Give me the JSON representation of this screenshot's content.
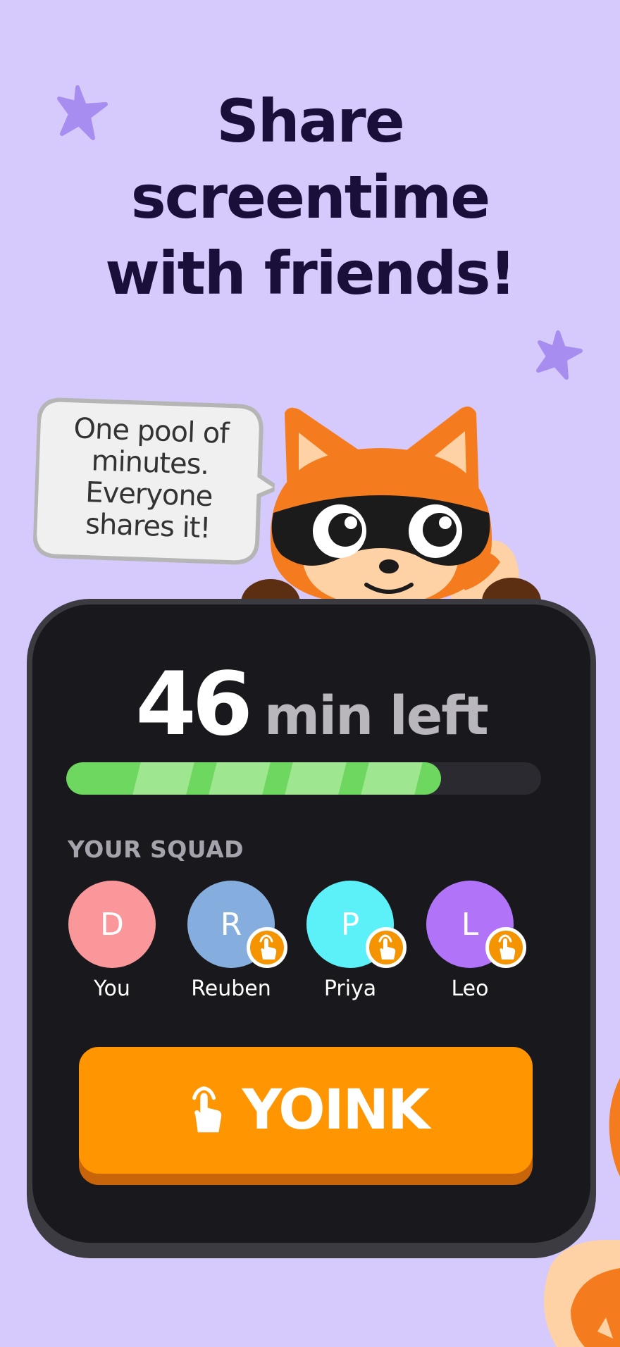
{
  "headline": {
    "line1": "Share",
    "line2": "screentime",
    "line3": "with friends!"
  },
  "bubble": {
    "line1": "One pool of",
    "line2": "minutes.",
    "line3": "Everyone",
    "line4": "shares it!"
  },
  "panel": {
    "minutes": "46",
    "minutes_label": "min left",
    "progress_fraction": 0.79,
    "squad_title": "YOUR SQUAD",
    "members": [
      {
        "initial": "D",
        "name": "You",
        "color": "#f9979b",
        "badge": false
      },
      {
        "initial": "R",
        "name": "Reuben",
        "color": "#85aede",
        "badge": true
      },
      {
        "initial": "P",
        "name": "Priya",
        "color": "#5cf0f9",
        "badge": true
      },
      {
        "initial": "L",
        "name": "Leo",
        "color": "#b173f8",
        "badge": true
      }
    ],
    "button_label": "YOINK",
    "button_icon": "tap-hand-icon"
  },
  "colors": {
    "background": "#d6c9fb",
    "accent": "#ff9500",
    "progress": "#6ed75f",
    "panel": "#19181c"
  }
}
